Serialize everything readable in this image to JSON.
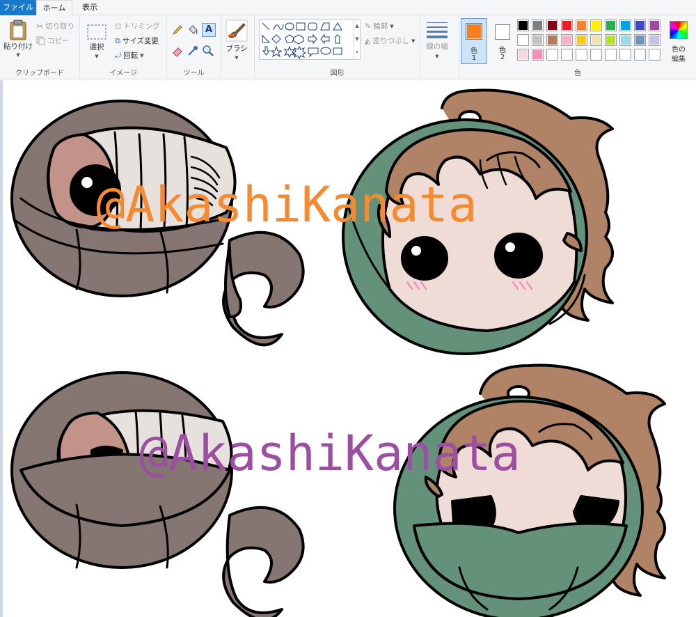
{
  "tabs": {
    "file": "ファイル",
    "home": "ホーム",
    "view": "表示"
  },
  "clipboard": {
    "paste": "貼り付け",
    "cut": "切り取り",
    "copy": "コピー",
    "label": "クリップボード"
  },
  "image": {
    "select": "選択",
    "crop": "トリミング",
    "resize": "サイズ変更",
    "rotate": "回転",
    "label": "イメージ"
  },
  "tools": {
    "label": "ツール"
  },
  "brushes": {
    "label": "ブラシ"
  },
  "shapes": {
    "outline": "輪郭",
    "fill": "塗りつぶし",
    "label": "図形"
  },
  "size": {
    "label": "線の幅"
  },
  "colors": {
    "color1_label": "色",
    "color1_num": "1",
    "color2_label": "色",
    "color2_num": "2",
    "edit_line1": "色の",
    "edit_line2": "編集",
    "label": "色",
    "color1_value": "#f77f20",
    "color2_value": "#ffffff",
    "palette_row1": [
      "#000000",
      "#7f7f7f",
      "#880015",
      "#ed1c24",
      "#ff7f27",
      "#fff200",
      "#22b14c",
      "#00a2e8",
      "#3f48cc",
      "#a349a4"
    ],
    "palette_row2": [
      "#ffffff",
      "#c3c3c3",
      "#b97a57",
      "#ffaec9",
      "#ffc90e",
      "#efe4b0",
      "#b5e61d",
      "#99d9ea",
      "#7092be",
      "#c8bfe7"
    ],
    "palette_row3": [
      "#f0dcd6",
      "#f58fb5",
      "#ffffff",
      "#ffffff",
      "#ffffff",
      "#ffffff",
      "#ffffff",
      "#ffffff",
      "#ffffff",
      "#ffffff"
    ]
  },
  "canvas": {
    "watermark_top": "@AkashiKanata",
    "watermark_bottom": "@AkashiKanata",
    "watermark_top_color": "#f78a2e",
    "watermark_bottom_color": "#9c4fa0"
  }
}
